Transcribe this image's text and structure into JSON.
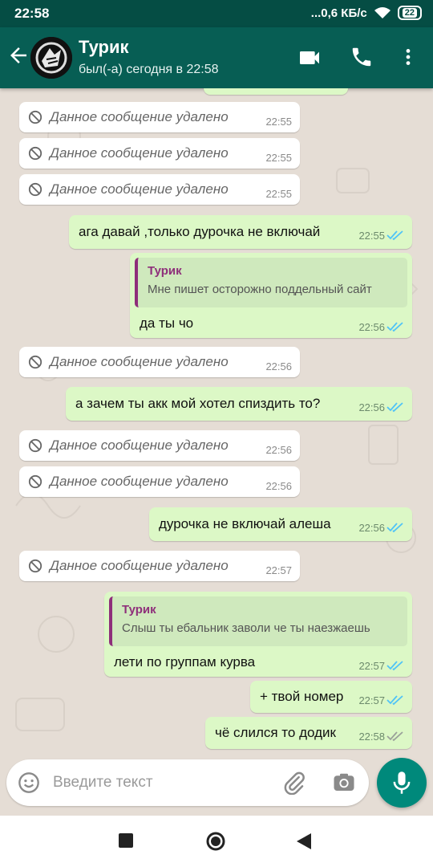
{
  "status_bar": {
    "time": "22:58",
    "network_speed": "...0,6 КБ/с",
    "battery": "22"
  },
  "header": {
    "contact_name": "Турик",
    "last_seen": "был(-а) сегодня в 22:58"
  },
  "messages": [
    {
      "type": "deleted",
      "text": "Данное сообщение удалено",
      "time": "22:55"
    },
    {
      "type": "deleted",
      "text": "Данное сообщение удалено",
      "time": "22:55"
    },
    {
      "type": "deleted",
      "text": "Данное сообщение удалено",
      "time": "22:55"
    },
    {
      "type": "outgoing",
      "text": "ага давай ,только дурочка не включай",
      "time": "22:55",
      "status": "read"
    },
    {
      "type": "outgoing_reply",
      "quote_author": "Турик",
      "quote_text": "Мне пишет осторожно поддельный сайт",
      "text": "да ты чо",
      "time": "22:56",
      "status": "read"
    },
    {
      "type": "deleted",
      "text": "Данное сообщение удалено",
      "time": "22:56"
    },
    {
      "type": "outgoing",
      "text": "а зачем ты акк мой хотел спиздить то?",
      "time": "22:56",
      "status": "read"
    },
    {
      "type": "deleted",
      "text": "Данное сообщение удалено",
      "time": "22:56"
    },
    {
      "type": "deleted",
      "text": "Данное сообщение удалено",
      "time": "22:56"
    },
    {
      "type": "outgoing",
      "text": "дурочка не включай алеша",
      "time": "22:56",
      "status": "read"
    },
    {
      "type": "deleted",
      "text": "Данное сообщение удалено",
      "time": "22:57"
    },
    {
      "type": "outgoing_reply",
      "quote_author": "Турик",
      "quote_text": "Слыш ты ебальник заволи че ты наезжаешь",
      "text": "лети по группам курва",
      "time": "22:57",
      "status": "read"
    },
    {
      "type": "outgoing",
      "text": "+ твой номер",
      "time": "22:57",
      "status": "read"
    },
    {
      "type": "outgoing",
      "text": "чё слился то додик",
      "time": "22:58",
      "status": "delivered"
    }
  ],
  "input": {
    "placeholder": "Введите текст"
  },
  "icons": {
    "back": "arrow-left-icon",
    "video": "video-call-icon",
    "call": "phone-icon",
    "menu": "more-vert-icon",
    "emoji": "emoji-icon",
    "attach": "paperclip-icon",
    "camera": "camera-icon",
    "mic": "microphone-icon"
  },
  "colors": {
    "header": "#075e54",
    "status_bar": "#054d44",
    "outgoing_bubble": "#dcf8c6",
    "incoming_bubble": "#ffffff",
    "read_ticks": "#4fc3f7",
    "mic_button": "#00897b",
    "quote_author": "#8e2f7a"
  }
}
